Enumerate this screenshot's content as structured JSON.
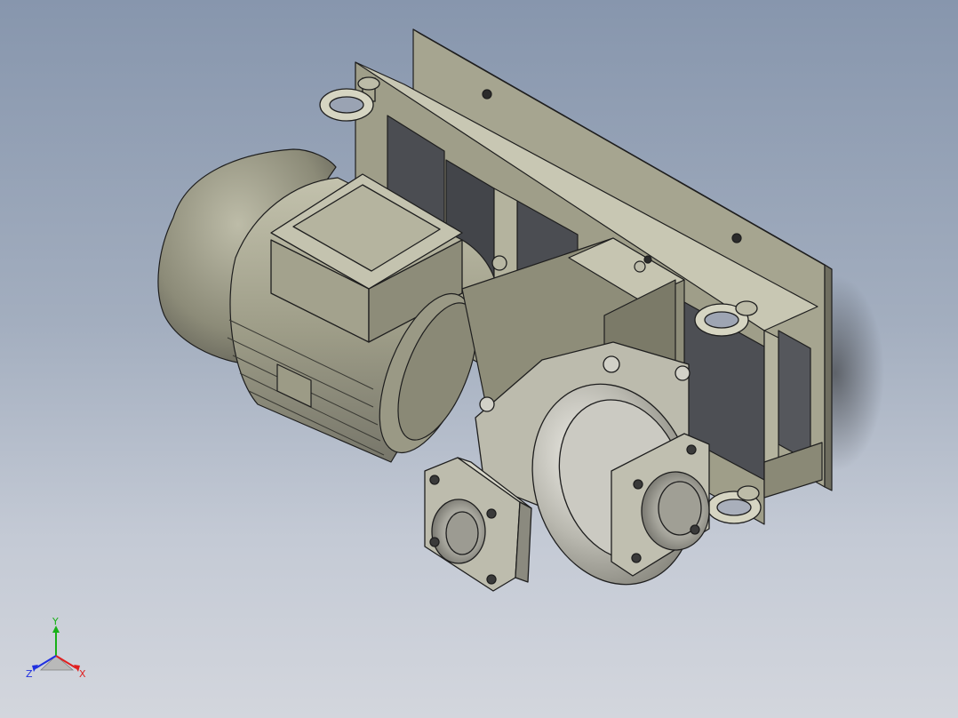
{
  "viewport": {
    "background_top": "#8796ad",
    "background_bottom": "#d3d6dd"
  },
  "model": {
    "colors": {
      "body": "#a9a892",
      "body_light": "#c9c8b4",
      "body_dark": "#7f7e6c",
      "body_shadow": "#5f5e52",
      "opening": "#4b4d52",
      "steel": "#c5c4bc",
      "steel_dark": "#8e8c82",
      "edge": "#1e1e1e"
    }
  },
  "triad": {
    "x_label": "X",
    "y_label": "Y",
    "z_label": "Z",
    "x_color": "#e02020",
    "y_color": "#18b018",
    "z_color": "#2030e0"
  }
}
